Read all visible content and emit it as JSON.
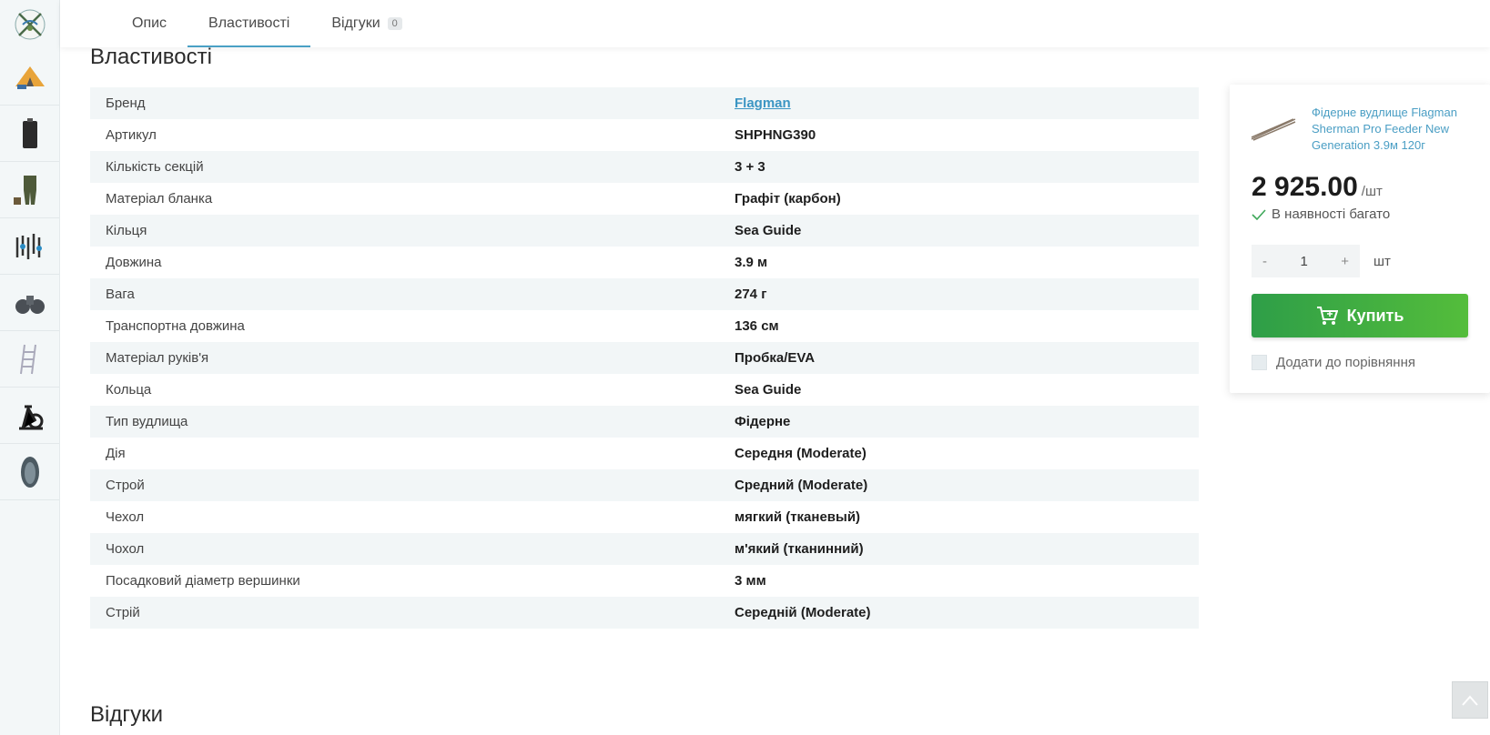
{
  "sidebar": {
    "logo": "fishing-gear-logo-icon",
    "items": [
      {
        "icon": "tent-thumb-icon"
      },
      {
        "icon": "suitcase-thumb-icon"
      },
      {
        "icon": "waders-thumb-icon"
      },
      {
        "icon": "tools-thumb-icon"
      },
      {
        "icon": "binoculars-thumb-icon"
      },
      {
        "icon": "ladder-thumb-icon"
      },
      {
        "icon": "exercise-bike-thumb-icon"
      },
      {
        "icon": "inflatable-boat-thumb-icon"
      }
    ]
  },
  "tabs": [
    {
      "label": "Опис"
    },
    {
      "label": "Властивості"
    },
    {
      "label": "Відгуки",
      "badge": "0"
    }
  ],
  "properties": {
    "title": "Властивості",
    "rows": [
      {
        "key": "Бренд",
        "value": "Flagman"
      },
      {
        "key": "Артикул",
        "value": "SHPHNG390"
      },
      {
        "key": "Кількість секцій",
        "value": "3 + 3"
      },
      {
        "key": "Матеріал бланка",
        "value": "Графіт (карбон)"
      },
      {
        "key": "Кільця",
        "value": "Sea Guide"
      },
      {
        "key": "Довжина",
        "value": "3.9 м"
      },
      {
        "key": "Вага",
        "value": "274 г"
      },
      {
        "key": "Транспортна довжина",
        "value": "136 см"
      },
      {
        "key": "Матеріал руків'я",
        "value": "Пробка/EVA"
      },
      {
        "key": "Кольца",
        "value": "Sea Guide"
      },
      {
        "key": "Тип вудлища",
        "value": "Фідерне"
      },
      {
        "key": "Дія",
        "value": "Середня (Moderate)"
      },
      {
        "key": "Строй",
        "value": "Средний (Moderate)"
      },
      {
        "key": "Чехол",
        "value": "мягкий (тканевый)"
      },
      {
        "key": "Чохол",
        "value": "м'який (тканинний)"
      },
      {
        "key": "Посадковий діаметр вершинки",
        "value": "3 мм"
      },
      {
        "key": "Стрій",
        "value": "Середній (Moderate)"
      }
    ]
  },
  "reviews": {
    "title": "Відгуки"
  },
  "card": {
    "product_name": "Фідерне вудлище Flagman Sherman Pro Feeder New Generation 3.9м 120г",
    "price": "2 925.00",
    "price_unit": "/шт",
    "stock": "В наявності багато",
    "qty_minus": "-",
    "qty_value": "1",
    "qty_plus": "+",
    "qty_unit": "шт",
    "buy_label": "Купить",
    "compare_label": "Додати до порівняння"
  },
  "colors": {
    "accent": "#4aa0c5",
    "buy_start": "#2e9e48",
    "buy_end": "#54bd3b"
  }
}
